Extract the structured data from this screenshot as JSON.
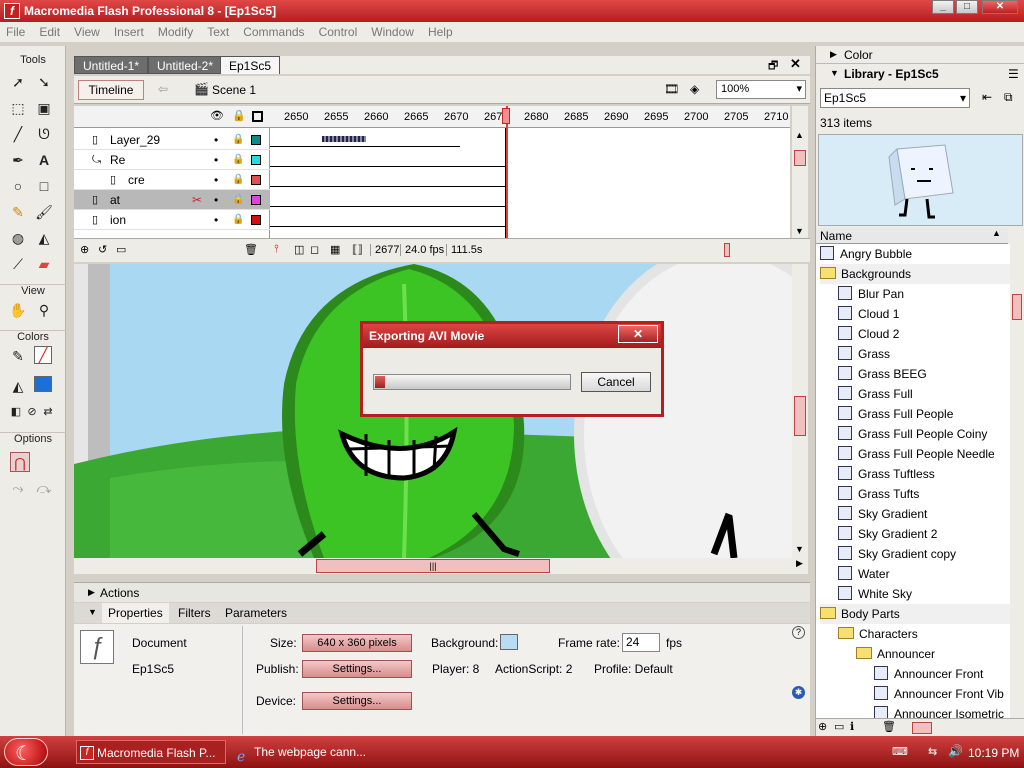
{
  "window": {
    "title": "Macromedia Flash Professional 8 - [Ep1Sc5]",
    "minimize": "_",
    "maximize": "□",
    "close": "✕"
  },
  "menu": [
    "File",
    "Edit",
    "View",
    "Insert",
    "Modify",
    "Text",
    "Commands",
    "Control",
    "Window",
    "Help"
  ],
  "tools": {
    "header": "Tools",
    "view_label": "View",
    "colors_label": "Colors",
    "options_label": "Options"
  },
  "document": {
    "tabs": [
      "Untitled-1*",
      "Untitled-2*",
      "Ep1Sc5"
    ],
    "timeline_button": "Timeline",
    "scene": "Scene 1",
    "zoom": "100%"
  },
  "timeline": {
    "frame_numbers": [
      "2650",
      "2655",
      "2660",
      "2665",
      "2670",
      "2675",
      "2680",
      "2685",
      "2690",
      "2695",
      "2700",
      "2705",
      "2710"
    ],
    "layers": [
      {
        "name": "Layer_29",
        "color": "#0f8a8a"
      },
      {
        "name": "Re",
        "color": "#22dddd"
      },
      {
        "name": "cre",
        "color": "#e05050"
      },
      {
        "name": "at",
        "color": "#e040e0"
      },
      {
        "name": "ion",
        "color": "#d01010"
      }
    ],
    "current_frame": "2677",
    "fps": "24.0 fps",
    "elapsed": "111.5s"
  },
  "dialog": {
    "title": "Exporting AVI Movie",
    "close": "✕",
    "cancel_label": "Cancel",
    "progress": 0.05
  },
  "actions": {
    "label": "Actions"
  },
  "properties": {
    "tabs": [
      "Properties",
      "Filters",
      "Parameters"
    ],
    "doc_label": "Document",
    "doc_name": "Ep1Sc5",
    "size_label": "Size:",
    "size_value": "640 x 360 pixels",
    "background_label": "Background:",
    "frame_rate_label": "Frame rate:",
    "frame_rate_value": "24",
    "fps_label": "fps",
    "publish_label": "Publish:",
    "settings_label": "Settings...",
    "player_label": "Player: 8",
    "actionscript_label": "ActionScript: 2",
    "profile_label": "Profile: Default",
    "device_label": "Device:",
    "device_settings_label": "Settings..."
  },
  "right_panel": {
    "color_label": "Color",
    "library_label": "Library - Ep1Sc5",
    "library_select": "Ep1Sc5",
    "items_count": "313 items",
    "name_col": "Name",
    "items": [
      {
        "name": "Angry Bubble",
        "type": "symbol",
        "indent": 0
      },
      {
        "name": "Backgrounds",
        "type": "folder",
        "indent": 0
      },
      {
        "name": "Blur Pan",
        "type": "symbol",
        "indent": 1
      },
      {
        "name": "Cloud 1",
        "type": "symbol",
        "indent": 1
      },
      {
        "name": "Cloud 2",
        "type": "symbol",
        "indent": 1
      },
      {
        "name": "Grass",
        "type": "symbol",
        "indent": 1
      },
      {
        "name": "Grass BEEG",
        "type": "symbol",
        "indent": 1
      },
      {
        "name": "Grass Full",
        "type": "symbol",
        "indent": 1
      },
      {
        "name": "Grass Full People",
        "type": "symbol",
        "indent": 1
      },
      {
        "name": "Grass Full People Coiny",
        "type": "symbol",
        "indent": 1
      },
      {
        "name": "Grass Full People Needle",
        "type": "symbol",
        "indent": 1
      },
      {
        "name": "Grass Tuftless",
        "type": "symbol",
        "indent": 1
      },
      {
        "name": "Grass Tufts",
        "type": "symbol",
        "indent": 1
      },
      {
        "name": "Sky Gradient",
        "type": "symbol",
        "indent": 1
      },
      {
        "name": "Sky Gradient 2",
        "type": "symbol",
        "indent": 1
      },
      {
        "name": "Sky Gradient copy",
        "type": "symbol",
        "indent": 1
      },
      {
        "name": "Water",
        "type": "symbol",
        "indent": 1
      },
      {
        "name": "White Sky",
        "type": "symbol",
        "indent": 1
      },
      {
        "name": "Body Parts",
        "type": "folder",
        "indent": 0
      },
      {
        "name": "Characters",
        "type": "folder",
        "indent": 1
      },
      {
        "name": "Announcer",
        "type": "folder",
        "indent": 2
      },
      {
        "name": "Announcer Front",
        "type": "symbol",
        "indent": 3
      },
      {
        "name": "Announcer Front Vib",
        "type": "symbol",
        "indent": 3
      },
      {
        "name": "Announcer Isometric",
        "type": "symbol",
        "indent": 3
      }
    ]
  },
  "taskbar": {
    "tasks": [
      "Macromedia Flash P...",
      "The webpage cann..."
    ],
    "clock": "10:19 PM"
  }
}
